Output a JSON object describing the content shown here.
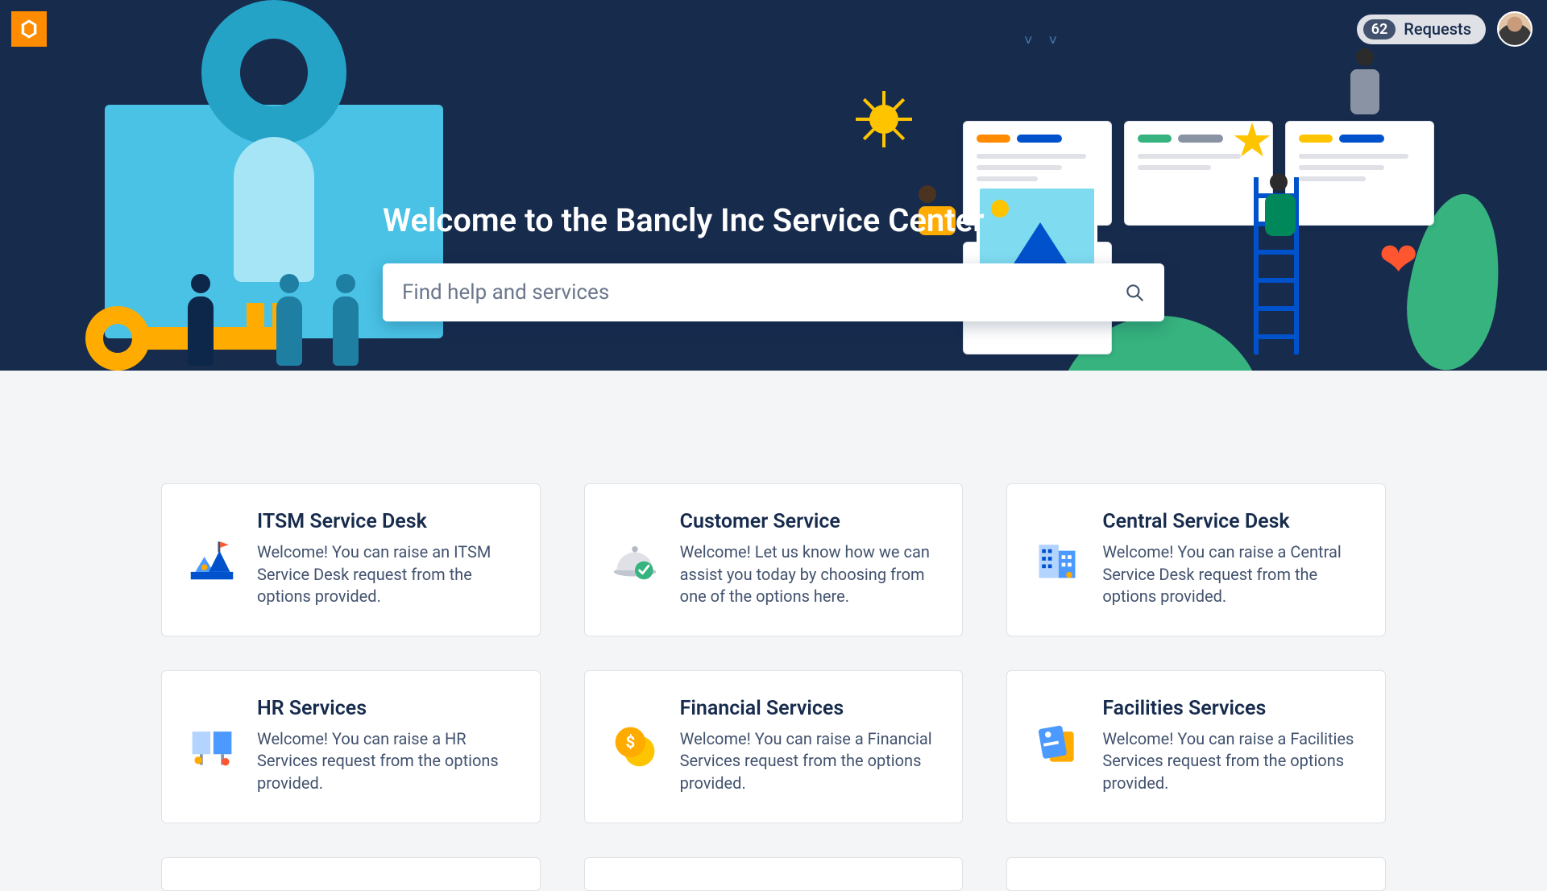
{
  "header": {
    "requests_count": "62",
    "requests_label": "Requests"
  },
  "hero": {
    "title": "Welcome to the Bancly Inc Service Center",
    "search_placeholder": "Find help and services"
  },
  "cards": [
    {
      "icon": "itsm",
      "title": "ITSM Service Desk",
      "desc": "Welcome! You can raise an ITSM Service Desk request from the options provided."
    },
    {
      "icon": "customer",
      "title": "Customer Service",
      "desc": "Welcome! Let us know how we can assist you today by choosing from one of the options here."
    },
    {
      "icon": "central",
      "title": "Central Service Desk",
      "desc": "Welcome! You can raise a Central Service Desk request from the options provided."
    },
    {
      "icon": "hr",
      "title": "HR Services",
      "desc": "Welcome! You can raise a HR Services request from the options provided."
    },
    {
      "icon": "finance",
      "title": "Financial Services",
      "desc": "Welcome! You can raise a Financial Services request from the options provided."
    },
    {
      "icon": "facilities",
      "title": "Facilities Services",
      "desc": "Welcome! You can raise a Facilities Services request from the options provided."
    }
  ]
}
